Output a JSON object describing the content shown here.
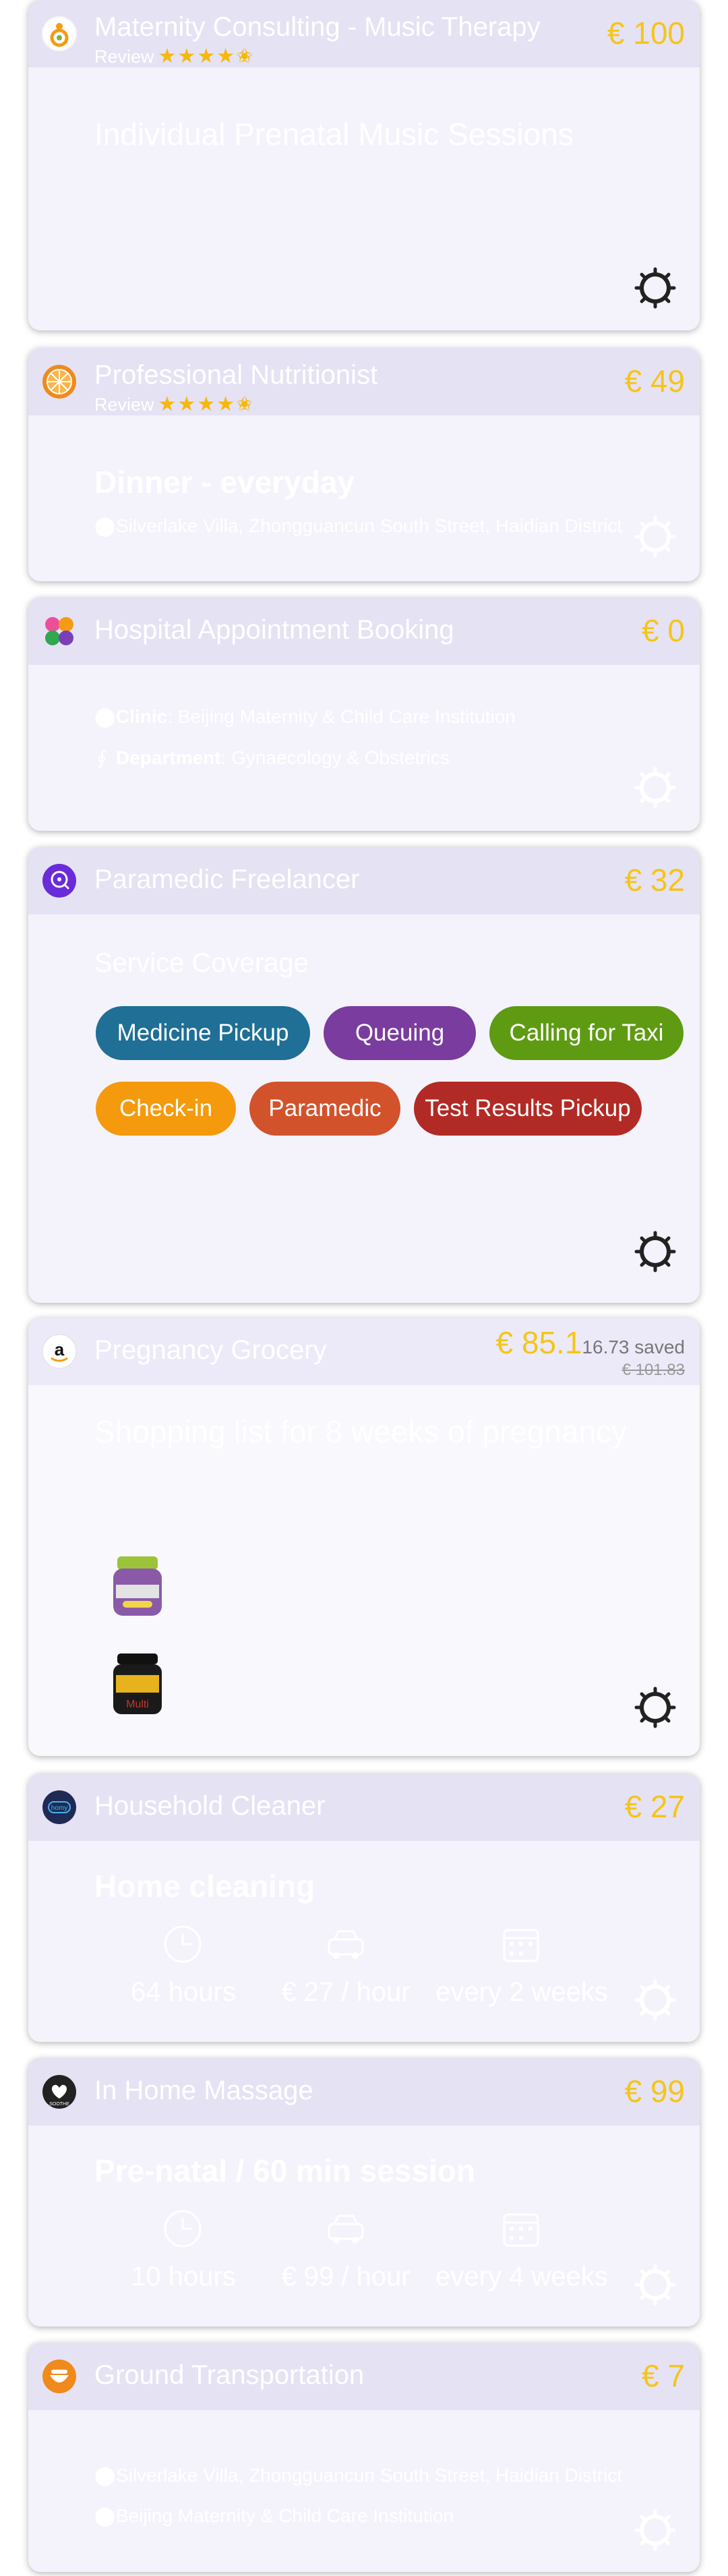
{
  "cards": [
    {
      "title": "Maternity Consulting - Music Therapy",
      "review_label": "Review",
      "rating": 4.5,
      "stars": "★★★★✬",
      "price": "€ 100",
      "headline": "Individual Prenatal Music Sessions",
      "detail": "",
      "logo_icon": "orange-figure-logo"
    },
    {
      "title": "Professional Nutritionist",
      "review_label": "Review",
      "rating": 4.5,
      "stars": "★★★★✬",
      "price": "€ 49",
      "headline": "Dinner - everyday",
      "address": "Silverlake Villa, Zhongguancun South Street, Haidian District",
      "logo_icon": "citrus-logo"
    },
    {
      "title": "Hospital Appointment Booking",
      "price": "€ 0",
      "clinic_label": "Clinic",
      "clinic_value": ": Beijing Maternity & Child Care Institution",
      "department_label": "Department",
      "department_value": ": Gynaecology & Obstetrics",
      "logo_icon": "petal-logo"
    },
    {
      "title": "Paramedic Freelancer",
      "price": "€ 32",
      "headline": "Service Coverage",
      "services": [
        "Medicine Pickup",
        "Queuing",
        "Calling for Taxi",
        "Check-in",
        "Paramedic",
        "Test Results Pickup"
      ],
      "service_colors": [
        "#1f6f96",
        "#7a3c9e",
        "#5e9b12",
        "#f59a0c",
        "#d2522c",
        "#b22a25"
      ],
      "logo_icon": "paramedic-logo"
    },
    {
      "title": "Pregnancy Grocery",
      "price": "€ 85.1",
      "saved": "16.73 saved",
      "original_price": "€ 101.83",
      "headline": "Shopping list for 8 weeks of pregnancy",
      "logo_icon": "amazon-logo"
    },
    {
      "title": "Household Cleaner",
      "price": "€ 27",
      "headline": "Home cleaning",
      "stats": [
        "64 hours",
        "€ 27 / hour",
        "every 2 weeks"
      ],
      "logo_icon": "homy-logo"
    },
    {
      "title": "In Home Massage",
      "price": "€ 99",
      "headline": "Pre-natal / 60 min session",
      "stats": [
        "10 hours",
        "€ 99 / hour",
        "every 4 weeks"
      ],
      "logo_icon": "soothe-logo"
    },
    {
      "title": "Ground Transportation",
      "price": "€ 7",
      "from": "Silverlake Villa, Zhongguancun South Street, Haidian District",
      "to": "Beijing Maternity & Child Care Institution",
      "logo_icon": "car-logo"
    }
  ],
  "colors": {
    "price": "#f5c518",
    "star": "#f5b80c",
    "header": "#e5e2f4"
  },
  "icons": [
    "sun-gear-icon",
    "map-pin-icon",
    "stethoscope-icon",
    "clock-icon",
    "car-icon",
    "calendar-icon"
  ]
}
